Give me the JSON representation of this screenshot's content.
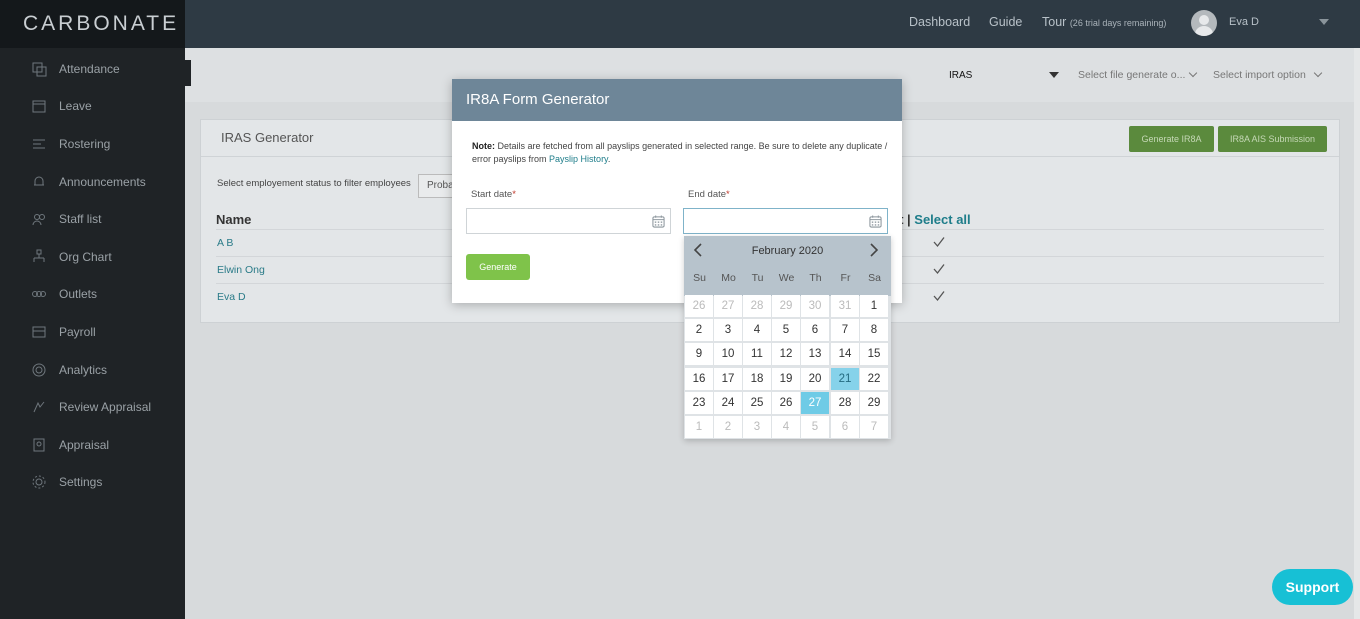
{
  "app": {
    "logo": "CARBONATE"
  },
  "sidebar": {
    "items": [
      {
        "label": "Attendance",
        "icon": "attendance-icon"
      },
      {
        "label": "Leave",
        "icon": "leave-icon"
      },
      {
        "label": "Rostering",
        "icon": "rostering-icon"
      },
      {
        "label": "Announcements",
        "icon": "bell-icon"
      },
      {
        "label": "Staff list",
        "icon": "staff-icon"
      },
      {
        "label": "Org Chart",
        "icon": "org-chart-icon"
      },
      {
        "label": "Outlets",
        "icon": "outlets-icon"
      },
      {
        "label": "Payroll",
        "icon": "payroll-icon"
      },
      {
        "label": "Analytics",
        "icon": "analytics-icon"
      },
      {
        "label": "Review Appraisal",
        "icon": "review-icon"
      },
      {
        "label": "Appraisal",
        "icon": "appraisal-icon"
      },
      {
        "label": "Settings",
        "icon": "gear-icon"
      }
    ]
  },
  "topbar": {
    "dashboard": "Dashboard",
    "guide": "Guide",
    "tour": "Tour",
    "trial": "(26 trial days remaining)",
    "user": "Eva D"
  },
  "subbar": {
    "iras_select": "IRAS",
    "file_generate": "Select file generate o...",
    "import_option": "Select import option"
  },
  "panel": {
    "title": "IRAS Generator",
    "generate_ir8a": "Generate IR8A",
    "ir8a_ais": "IR8A AIS Submission",
    "filter_label": "Select employement status to filter employees",
    "filter_value": "Proba",
    "col_name": "Name",
    "col_select_prefix": "lect |",
    "col_select_all": "Select all",
    "rows": [
      "A B",
      "Elwin Ong",
      "Eva D"
    ]
  },
  "modal": {
    "title": "IR8A Form Generator",
    "note_label": "Note:",
    "note_text": "Details are fetched from all payslips generated in selected range. Be sure to delete any duplicate / error payslips from",
    "note_link": "Payslip History",
    "note_end": ".",
    "start_label": "Start date",
    "end_label": "End date",
    "required_mark": "*",
    "generate": "Generate"
  },
  "calendar": {
    "title": "February 2020",
    "weekdays": [
      "Su",
      "Mo",
      "Tu",
      "We",
      "Th",
      "Fr",
      "Sa"
    ],
    "weeks": [
      [
        "26",
        "27",
        "28",
        "29",
        "30",
        "31",
        "1"
      ],
      [
        "2",
        "3",
        "4",
        "5",
        "6",
        "7",
        "8"
      ],
      [
        "9",
        "10",
        "11",
        "12",
        "13",
        "14",
        "15"
      ],
      [
        "16",
        "17",
        "18",
        "19",
        "20",
        "21",
        "22"
      ],
      [
        "23",
        "24",
        "25",
        "26",
        "27",
        "28",
        "29"
      ],
      [
        "1",
        "2",
        "3",
        "4",
        "5",
        "6",
        "7"
      ]
    ],
    "selected_day": "21",
    "today_day": "27"
  },
  "support": "Support",
  "colors": {
    "sidebar": "#1f2326",
    "topbar": "#2e3a44",
    "modal_header": "#6e8698",
    "accent": "#17c0d5",
    "green": "#7fc34a"
  }
}
